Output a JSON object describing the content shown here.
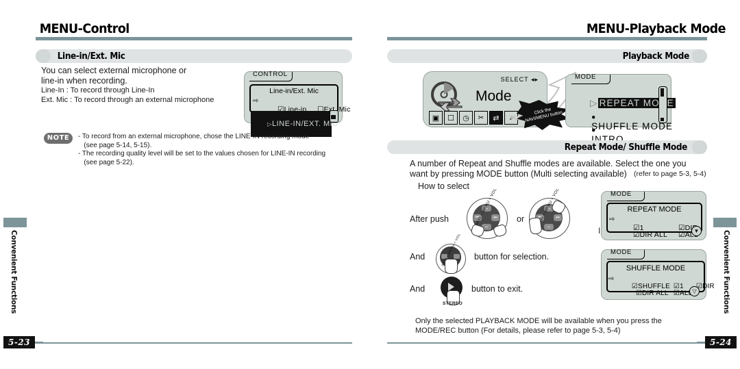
{
  "left_page": {
    "header_title": "MENU-Control",
    "section_title": "Line-in/Ext. Mic",
    "body_lines": "You can select external microphone or\nline-in when recording.",
    "detail_lines": "Line-In : To record through Line-In\nExt. Mic : To record through an external microphone",
    "lcd": {
      "tab_label": "CONTROL",
      "screen_title": "Line-in/Ext. Mic",
      "option_checked": "Line-in",
      "option_unchecked": "Ext. Mic",
      "bottom_row": "LINE-IN/EXT. MIC"
    },
    "note": {
      "badge": "NOTE",
      "text": "- To record from an external microphone, chose the LINE-IN recording mode\n   (see page 5-14, 5-15).\n- The recording quality level will be set to the values chosen for LINE-IN recording\n   (see page 5-22)."
    },
    "side_tab_label": "Convenient Functions",
    "page_number": "5-23"
  },
  "right_page": {
    "header_title": "MENU-Playback Mode",
    "section_playback_title": "Playback Mode",
    "section_repeat_title": "Repeat Mode/ Shuffle Mode",
    "mode_illustration": {
      "select_label": "SELECT",
      "word": "Mode",
      "icons": [
        "box-icon",
        "display-icon",
        "clock-icon",
        "tools-icon",
        "repeat-icon",
        "music-note-icon"
      ],
      "selected_icon_index": 4,
      "burst_text": "Click the\nNAVI/MENU button"
    },
    "mode_panel": {
      "tab_label": "MODE",
      "items": [
        "REPEAT MODE",
        "SHUFFLE MODE",
        "INTRO"
      ],
      "highlighted_index": 0
    },
    "intro_paragraph": "A number of Repeat and Shuffle modes are available. Select the one you\nwant by pressing MODE button (Multi selecting available)",
    "intro_paragraph_ref": "(refer to page 5-3, 5-4)",
    "how_to_select": "How to select",
    "step_after_push": "After push",
    "step_or": "or",
    "step_and_1": "And",
    "step_select_suffix": "button for selection.",
    "step_and_2": "And",
    "step_exit_suffix": "button to exit.",
    "stereo_label": "STEREO",
    "joystick_label": "NAVI • MENU • VOL",
    "repeat_lcd": {
      "tab_label": "MODE",
      "title": "REPEAT MODE",
      "opts_col1": [
        "1",
        "DIR ALL"
      ],
      "opts_col2": [
        "DIR",
        "ALL"
      ],
      "behind_text": "INTRO"
    },
    "shuffle_lcd": {
      "tab_label": "MODE",
      "title": "SHUFFLE MODE",
      "row1": [
        "SHUFFLE",
        "1",
        "DIR"
      ],
      "row2": [
        "DIR ALL",
        "ALL"
      ]
    },
    "footer_note": "Only the selected PLAYBACK MODE will be available when you press the\nMODE/REC button (For details, please refer to page 5-3, 5-4)",
    "side_tab_label": "Convenient Functions",
    "page_number": "5-24"
  },
  "colors": {
    "rule": "#7d9499",
    "section_bar": "#dfe3e3",
    "lcd_bg": "#cfd8d2",
    "ink": "#111111"
  }
}
